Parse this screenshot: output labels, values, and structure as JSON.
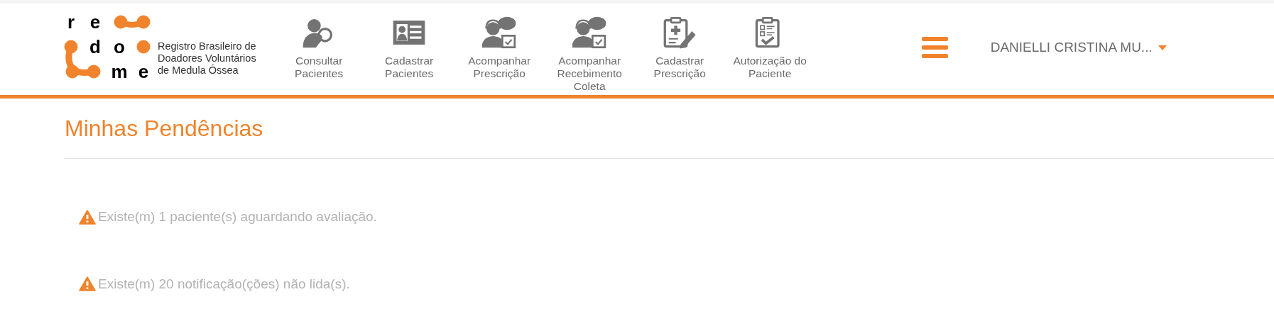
{
  "logo": {
    "letters": [
      "r",
      "e",
      "d",
      "o",
      "m",
      "e"
    ],
    "tagline": [
      "Registro Brasileiro de",
      "Doadores Voluntários",
      "de Medula Óssea"
    ]
  },
  "nav": [
    {
      "kind": "user-search",
      "label": [
        "Consultar",
        "Pacientes"
      ]
    },
    {
      "kind": "id-card",
      "label": [
        "Cadastrar",
        "Pacientes"
      ]
    },
    {
      "kind": "agent",
      "label": [
        "Acompanhar",
        "Prescrição"
      ]
    },
    {
      "kind": "agent",
      "label": [
        "Acompanhar",
        "Recebimento",
        "Coleta"
      ]
    },
    {
      "kind": "clipboard-edit",
      "label": [
        "Cadastrar",
        "Prescrição"
      ]
    },
    {
      "kind": "checklist",
      "label": [
        "Autorização do",
        "Paciente"
      ]
    }
  ],
  "user": {
    "name": "DANIELLI CRISTINA MU..."
  },
  "page_title": "Minhas Pendências",
  "alerts": [
    "Existe(m) 1 paciente(s) aguardando avaliação.",
    "Existe(m) 20 notificação(ções) não lida(s)."
  ]
}
